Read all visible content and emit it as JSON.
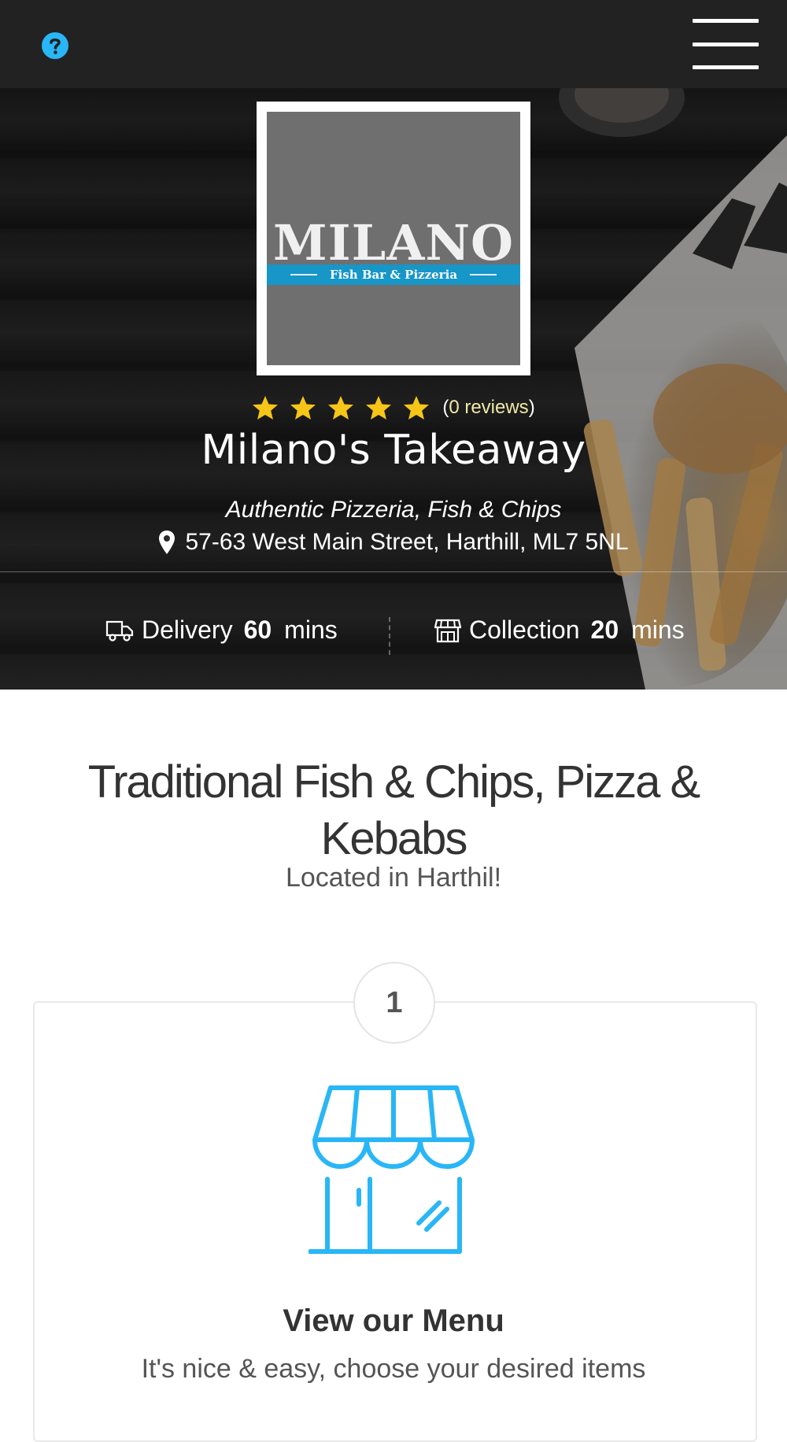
{
  "header": {
    "help_icon": "question-circle-icon",
    "menu_icon": "hamburger-menu-icon"
  },
  "hero": {
    "logo": {
      "word": "MILANO",
      "sub": "Fish Bar & Pizzeria"
    },
    "rating": {
      "stars": 5,
      "reviews_open": "(",
      "reviews_count": "0 reviews",
      "reviews_close": ")"
    },
    "name": "Milano's Takeaway",
    "tagline": "Authentic Pizzeria, Fish & Chips",
    "address": "57-63 West Main Street, Harthill, ML7 5NL",
    "delivery": {
      "label": "Delivery",
      "value": "60",
      "unit": "mins"
    },
    "collection": {
      "label": "Collection",
      "value": "20",
      "unit": "mins"
    }
  },
  "intro": {
    "title": "Traditional Fish & Chips, Pizza & Kebabs",
    "subtitle": "Located in Harthil!"
  },
  "steps": [
    {
      "number": "1",
      "icon": "shop-front-icon",
      "title": "View our Menu",
      "text": "It's nice & easy, choose your desired items"
    }
  ],
  "colors": {
    "accent": "#29b6f6",
    "star": "#f5c518",
    "header_bg": "#222222",
    "logo_band": "#1796c8"
  }
}
